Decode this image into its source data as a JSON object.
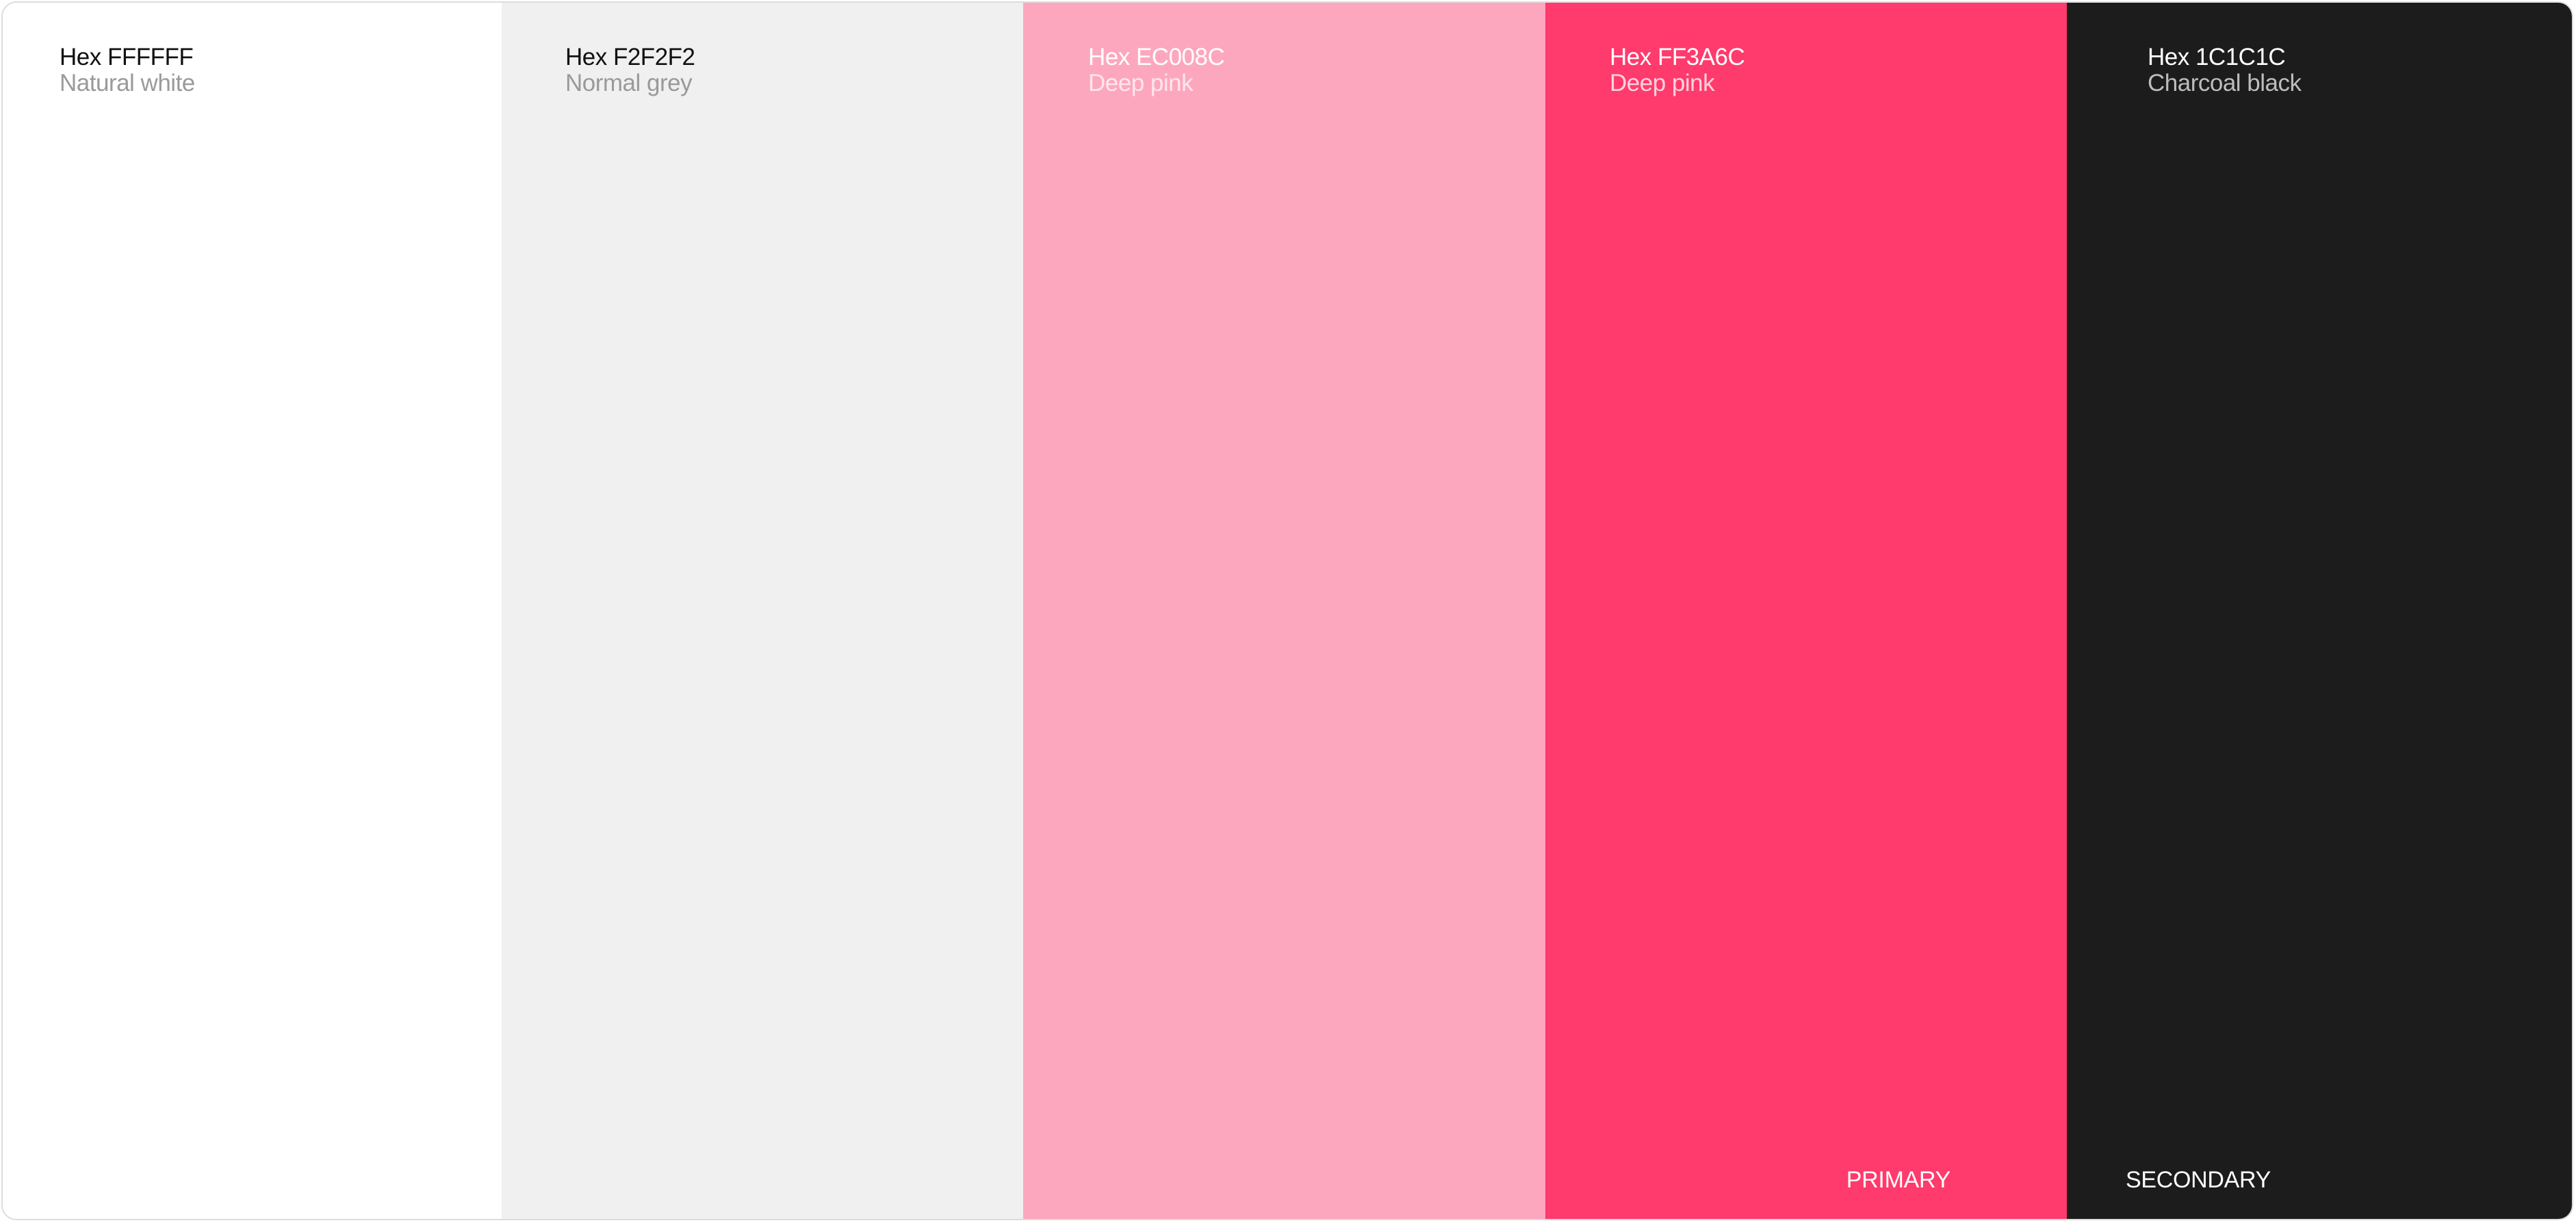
{
  "swatches": [
    {
      "hex_label": "Hex FFFFFF",
      "name": "Natural white",
      "fill": "#FFFFFF",
      "hex_color": "#111111",
      "name_color": "#9a9a9a"
    },
    {
      "hex_label": "Hex F2F2F2",
      "name": "Normal grey",
      "fill": "#F0F0F0",
      "hex_color": "#111111",
      "name_color": "#9a9a9a"
    },
    {
      "hex_label": "Hex EC008C",
      "name": "Deep pink",
      "fill": "#FDA7BF",
      "hex_color": "#ffffff",
      "name_color": "#ffe6ee"
    },
    {
      "hex_label": "Hex FF3A6C",
      "name": "Deep pink",
      "fill": "#FF3A6C",
      "hex_color": "#ffffff",
      "name_color": "#ffd3de",
      "role": "PRIMARY"
    },
    {
      "hex_label": "Hex 1C1C1C",
      "name": "Charcoal black",
      "fill": "#1C1C1C",
      "hex_color": "#ffffff",
      "name_color": "#bdbdbd",
      "role": "SECONDARY"
    }
  ]
}
